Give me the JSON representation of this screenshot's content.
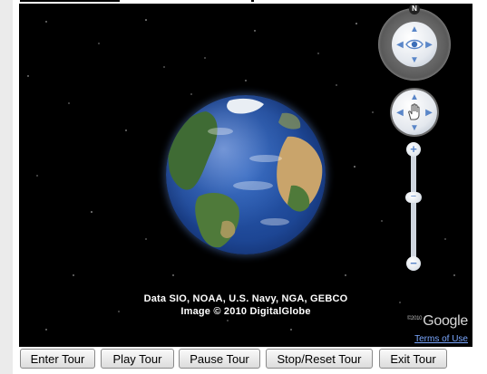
{
  "map": {
    "attribution_line1": "Data SIO, NOAA, U.S. Navy, NGA, GEBCO",
    "attribution_line2": "Image © 2010 DigitalGlobe",
    "logo_copyright": "©2010",
    "logo_text": "Google",
    "terms_link": "Terms of Use"
  },
  "navigation": {
    "north_label": "N",
    "look_icon": "eye-icon",
    "move_icon": "hand-icon",
    "zoom_in_label": "+",
    "zoom_out_label": "−",
    "zoom_level": 0.38
  },
  "tour_controls": {
    "buttons": [
      "Enter Tour",
      "Play Tour",
      "Pause Tour",
      "Stop/Reset Tour",
      "Exit Tour"
    ]
  },
  "colors": {
    "space_background": "#000000",
    "ocean": "#1d4694",
    "land_green": "#4f7a3a",
    "land_desert": "#c9a46b",
    "link": "#7aa7ff"
  }
}
